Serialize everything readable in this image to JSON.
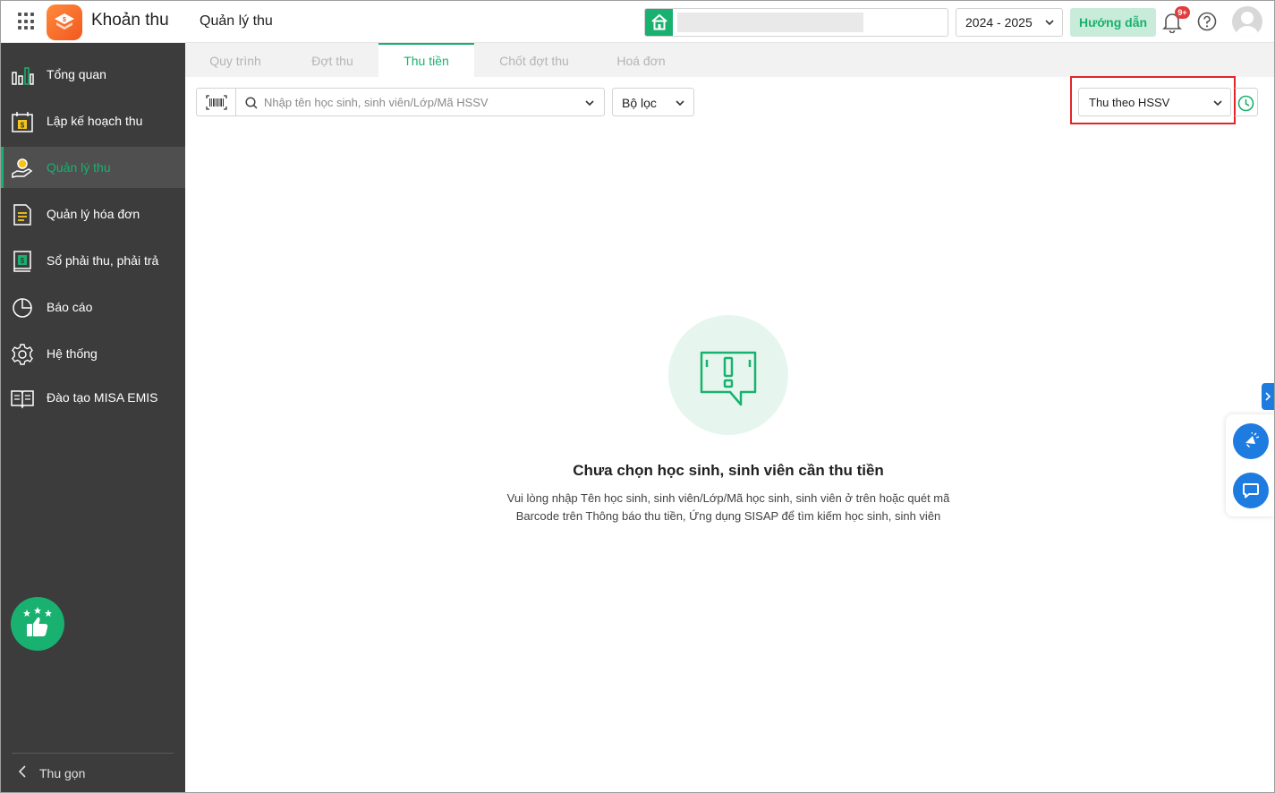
{
  "header": {
    "app_title": "Khoản thu",
    "module_title": "Quản lý thu",
    "school_year": "2024 - 2025",
    "guide_label": "Hướng dẫn",
    "notification_count": "9+"
  },
  "sidebar": {
    "items": [
      {
        "label": "Tổng quan",
        "icon": "chart-bars-icon",
        "active": false
      },
      {
        "label": "Lập kế hoạch thu",
        "icon": "calendar-dollar-icon",
        "active": false
      },
      {
        "label": "Quản lý thu",
        "icon": "hand-coin-icon",
        "active": true
      },
      {
        "label": "Quản lý hóa đơn",
        "icon": "document-icon",
        "active": false
      },
      {
        "label": "Sổ phải thu, phải trả",
        "icon": "ledger-book-icon",
        "active": false
      },
      {
        "label": "Báo cáo",
        "icon": "pie-chart-icon",
        "active": false
      },
      {
        "label": "Hệ thống",
        "icon": "gear-icon",
        "active": false
      },
      {
        "label": "Đào tạo MISA EMIS",
        "icon": "open-book-icon",
        "active": false
      }
    ],
    "collapse_label": "Thu gọn"
  },
  "tabs": [
    {
      "label": "Quy trình",
      "active": false
    },
    {
      "label": "Đợt thu",
      "active": false
    },
    {
      "label": "Thu tiền",
      "active": true
    },
    {
      "label": "Chốt đợt thu",
      "active": false
    },
    {
      "label": "Hoá đơn",
      "active": false
    }
  ],
  "toolbar": {
    "search_placeholder": "Nhập tên học sinh, sinh viên/Lớp/Mã HSSV",
    "filter_label": "Bộ lọc",
    "mode_value": "Thu theo HSSV"
  },
  "empty_state": {
    "title": "Chưa chọn học sinh, sinh viên cần thu tiền",
    "desc_line1": "Vui lòng nhập Tên học sinh, sinh viên/Lớp/Mã học sinh, sinh viên ở trên hoặc quét mã",
    "desc_line2": "Barcode trên Thông báo thu tiền, Ứng dụng SISAP để tìm kiếm học sinh, sinh viên"
  },
  "colors": {
    "accent": "#19b16f",
    "sidebar_bg": "#3c3c3c",
    "highlight_border": "#e0262b",
    "float_blue": "#1e7be0"
  }
}
